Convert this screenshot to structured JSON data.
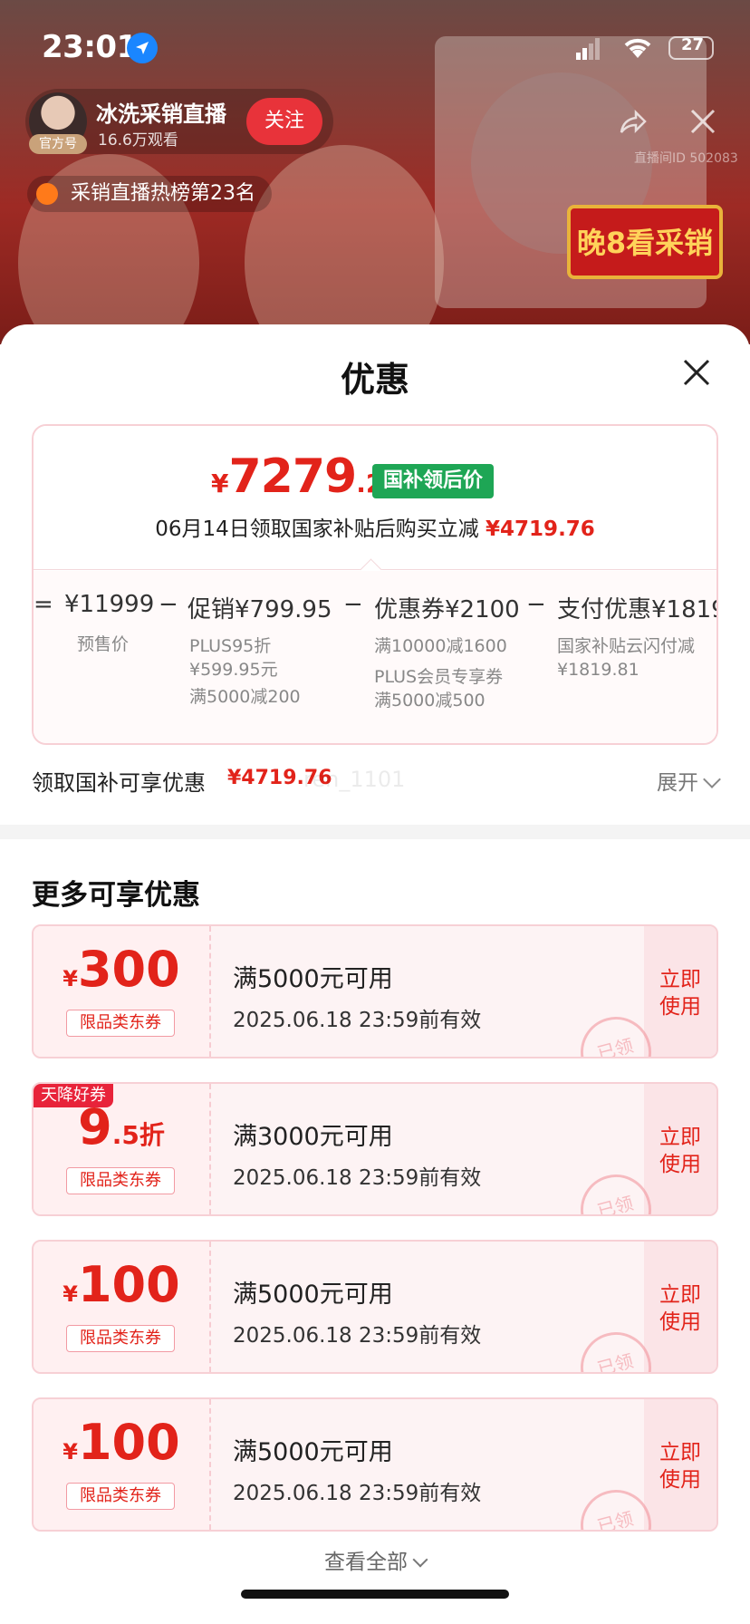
{
  "status_bar": {
    "time": "23:01",
    "battery": "27"
  },
  "live": {
    "streamer_name": "冰洗采销直播",
    "viewers": "16.6万观看",
    "official_badge": "官方号",
    "follow_label": "关注",
    "ranking_text": "采销直播热榜第23名",
    "sign_text": "晚8看采销",
    "room_id": "直播间ID 502083"
  },
  "sheet": {
    "title": "优惠",
    "final_price": {
      "currency": "¥",
      "integer": "7279",
      "decimal": ".24"
    },
    "badge": "国补领后价",
    "saving_text": "06月14日领取国家补贴后购买立减",
    "saving_amount": "¥4719.76",
    "calc": {
      "eq": "=",
      "presale_value": "¥11999",
      "presale_label": "预售价",
      "minus1": "−",
      "promo_value": "促销¥799.95",
      "promo_note1": "PLUS95折",
      "promo_note1b": "¥599.95元",
      "promo_note2": "满5000减200",
      "minus2": "−",
      "coupon_value": "优惠券¥2100",
      "coupon_note1": "满10000减1600",
      "coupon_note2": "PLUS会员专享券",
      "coupon_note2b": "满5000减500",
      "minus3": "−",
      "pay_value": "支付优惠¥1819",
      "pay_note1": "国家补贴云闪付减",
      "pay_note1b": "¥1819.81"
    },
    "claim_label": "领取国补可享优惠",
    "claim_amount": "¥4719.76",
    "watermark": "ren_1101",
    "expand_label": "展开",
    "more_title": "更多可享优惠",
    "coupons": [
      {
        "currency": "¥",
        "amount": "300",
        "suffix": "",
        "type": "限品类东券",
        "condition": "满5000元可用",
        "validity": "2025.06.18 23:59前有效",
        "action": "立即\n使用",
        "stamp": "已领",
        "badge": ""
      },
      {
        "currency": "",
        "amount": "9",
        "suffix": ".5折",
        "type": "限品类东券",
        "condition": "满3000元可用",
        "validity": "2025.06.18 23:59前有效",
        "action": "立即\n使用",
        "stamp": "已领",
        "badge": "天降好券"
      },
      {
        "currency": "¥",
        "amount": "100",
        "suffix": "",
        "type": "限品类东券",
        "condition": "满5000元可用",
        "validity": "2025.06.18 23:59前有效",
        "action": "立即\n使用",
        "stamp": "已领",
        "badge": ""
      },
      {
        "currency": "¥",
        "amount": "100",
        "suffix": "",
        "type": "限品类东券",
        "condition": "满5000元可用",
        "validity": "2025.06.18 23:59前有效",
        "action": "立即\n使用",
        "stamp": "已领",
        "badge": ""
      }
    ],
    "view_all": "查看全部"
  },
  "colors": {
    "accent_red": "#e2231a",
    "subsidy_green": "#1ea655",
    "location_blue": "#1a86ff"
  },
  "icons": [
    "location-icon",
    "signal-icon",
    "wifi-icon",
    "battery-icon",
    "share-icon",
    "close-icon",
    "chevron-down-icon"
  ]
}
